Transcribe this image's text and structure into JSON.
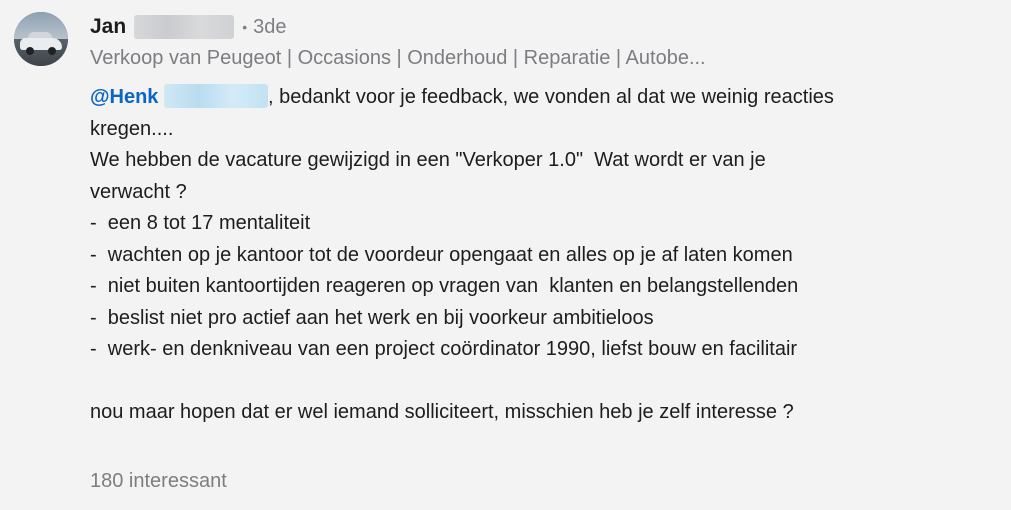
{
  "comment": {
    "author": {
      "first_name": "Jan",
      "separator": "•",
      "connection_degree": "3de",
      "headline": "Verkoop van Peugeot | Occasions | Onderhoud | Reparatie | Autobe..."
    },
    "mention": {
      "name": "@Henk"
    },
    "lines": [
      ", bedankt voor je feedback, we vonden al dat we weinig reacties",
      "kregen....",
      "We hebben de vacature gewijzigd in een \"Verkoper 1.0\"  Wat wordt er van je",
      "verwacht ?",
      "-  een 8 tot 17 mentaliteit",
      "-  wachten op je kantoor tot de voordeur opengaat en alles op je af laten komen",
      "-  niet buiten kantoortijden reageren op vragen van  klanten en belangstellenden",
      "-  beslist niet pro actief aan het werk en bij voorkeur ambitieloos",
      "-  werk- en denkniveau van een project coördinator 1990, liefst bouw en facilitair",
      "",
      "nou maar hopen dat er wel iemand solliciteert, misschien heb je zelf interesse ?"
    ],
    "reactions": "180 interessant"
  },
  "colors": {
    "background": "#f3f3f4",
    "mention": "#0a66c2",
    "muted_text": "#7b7d80",
    "primary_text": "#1d1d1f"
  }
}
